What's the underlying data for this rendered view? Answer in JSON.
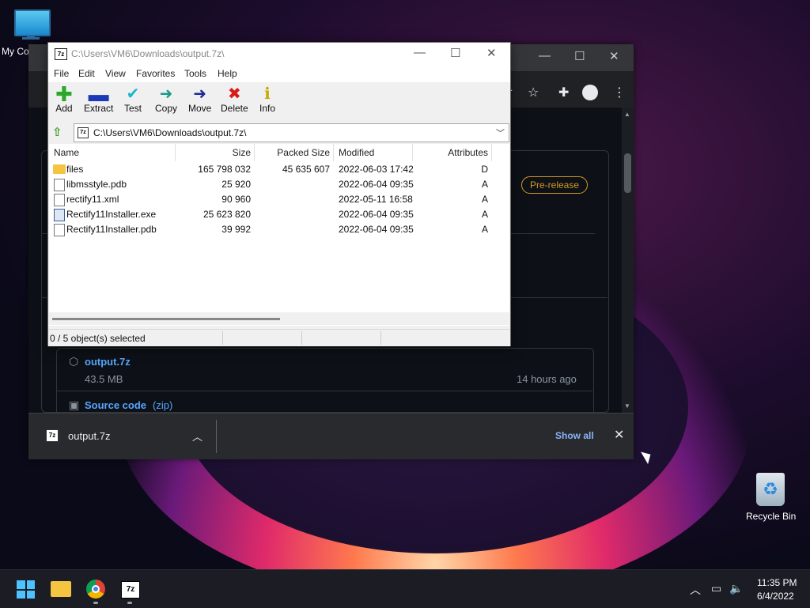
{
  "desktop": {
    "my_computer_label": "My Co",
    "recycle_bin_label": "Recycle Bin"
  },
  "chrome": {
    "prerelease_badge": "Pre-release",
    "asset_name": "output.7z",
    "asset_size": "43.5 MB",
    "asset_time": "14 hours ago",
    "source_label": "Source code",
    "source_format": "(zip)",
    "download_item": "output.7z",
    "show_all": "Show all"
  },
  "zip": {
    "app_icon": "7z",
    "title": "C:\\Users\\VM6\\Downloads\\output.7z\\",
    "menu": [
      "File",
      "Edit",
      "View",
      "Favorites",
      "Tools",
      "Help"
    ],
    "toolbar": [
      {
        "label": "Add",
        "icon": "plus-icon",
        "color": "#2aa82a"
      },
      {
        "label": "Extract",
        "icon": "minus-icon",
        "color": "#1a3ab8"
      },
      {
        "label": "Test",
        "icon": "check-icon",
        "color": "#1ab8c8"
      },
      {
        "label": "Copy",
        "icon": "arrow-right-icon",
        "color": "#1a9a8a"
      },
      {
        "label": "Move",
        "icon": "arrow-right-icon",
        "color": "#1a2a9a"
      },
      {
        "label": "Delete",
        "icon": "x-icon",
        "color": "#d81a1a"
      },
      {
        "label": "Info",
        "icon": "info-icon",
        "color": "#c8a800"
      }
    ],
    "address": "C:\\Users\\VM6\\Downloads\\output.7z\\",
    "columns": [
      "Name",
      "Size",
      "Packed Size",
      "Modified",
      "Attributes"
    ],
    "rows": [
      {
        "name": "files",
        "size": "165 798 032",
        "packed": "45 635 607",
        "modified": "2022-06-03 17:42",
        "attr": "D",
        "type": "folder"
      },
      {
        "name": "libmsstyle.pdb",
        "size": "25 920",
        "packed": "",
        "modified": "2022-06-04 09:35",
        "attr": "A",
        "type": "file"
      },
      {
        "name": "rectify11.xml",
        "size": "90 960",
        "packed": "",
        "modified": "2022-05-11 16:58",
        "attr": "A",
        "type": "file"
      },
      {
        "name": "Rectify11Installer.exe",
        "size": "25 623 820",
        "packed": "",
        "modified": "2022-06-04 09:35",
        "attr": "A",
        "type": "exe"
      },
      {
        "name": "Rectify11Installer.pdb",
        "size": "39 992",
        "packed": "",
        "modified": "2022-06-04 09:35",
        "attr": "A",
        "type": "file"
      }
    ],
    "status": "0 / 5 object(s) selected"
  },
  "taskbar": {
    "time": "11:35 PM",
    "date": "6/4/2022",
    "app_7z_label": "7z"
  }
}
